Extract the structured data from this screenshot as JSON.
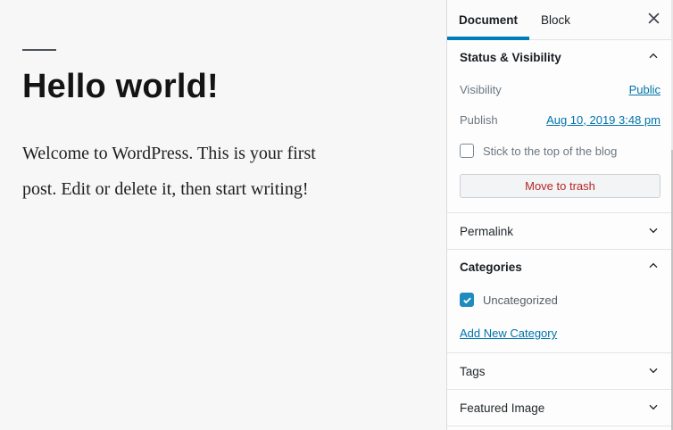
{
  "editor": {
    "title": "Hello world!",
    "paragraph_lines": [
      "Welcome to WordPress. This is your first",
      "post. Edit or delete it, then start writing!"
    ]
  },
  "sidebar": {
    "tabs": {
      "document": "Document",
      "block": "Block"
    },
    "panels": {
      "status": {
        "title": "Status & Visibility",
        "visibility_label": "Visibility",
        "visibility_value": "Public",
        "publish_label": "Publish",
        "publish_value": "Aug 10, 2019 3:48 pm",
        "sticky_label": "Stick to the top of the blog",
        "trash_label": "Move to trash"
      },
      "permalink": {
        "title": "Permalink"
      },
      "categories": {
        "title": "Categories",
        "items": [
          {
            "label": "Uncategorized",
            "checked": true
          }
        ],
        "add_link": "Add New Category"
      },
      "tags": {
        "title": "Tags"
      },
      "featured_image": {
        "title": "Featured Image"
      }
    },
    "colors": {
      "accent": "#007cba",
      "link": "#0073aa",
      "danger": "#b52727",
      "checkbox_checked": "#1e8cbe"
    }
  }
}
